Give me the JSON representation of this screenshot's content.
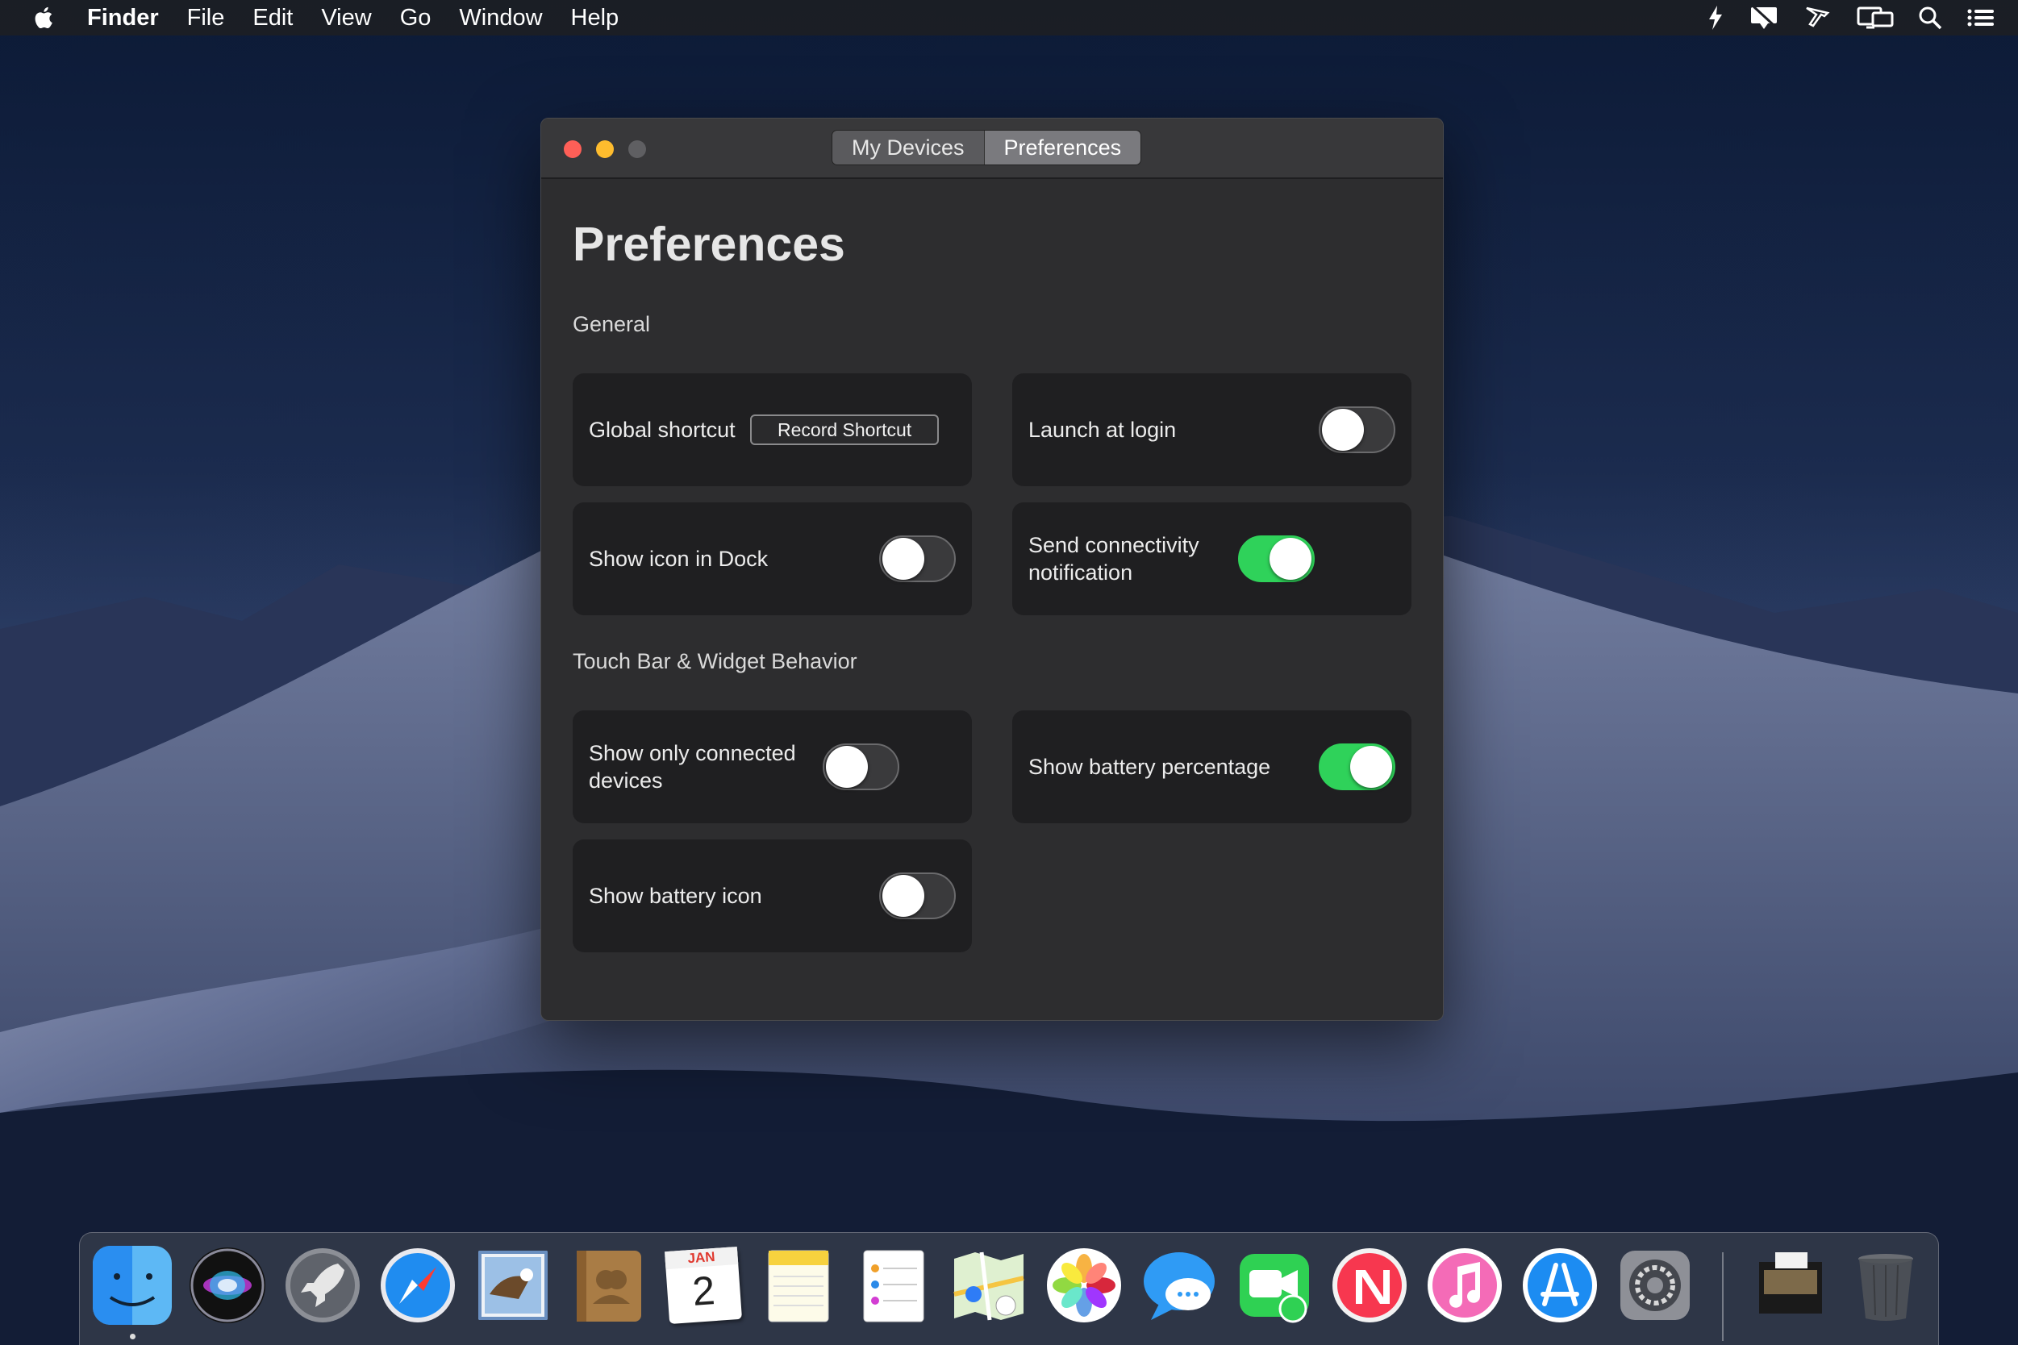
{
  "menubar": {
    "app_name": "Finder",
    "items": [
      "File",
      "Edit",
      "View",
      "Go",
      "Window",
      "Help"
    ],
    "status_icons": [
      "bolt-icon",
      "notification-icon",
      "airplay-icon",
      "displays-icon",
      "search-icon",
      "list-icon"
    ]
  },
  "window": {
    "tabs": [
      {
        "label": "My Devices",
        "selected": false
      },
      {
        "label": "Preferences",
        "selected": true
      }
    ],
    "title": "Preferences",
    "sections": [
      {
        "label": "General",
        "cards": [
          {
            "label": "Global shortcut",
            "control": "button",
            "button_label": "Record Shortcut"
          },
          {
            "label": "Launch at login",
            "control": "toggle",
            "on": false
          },
          {
            "label": "Show icon in Dock",
            "control": "toggle",
            "on": false
          },
          {
            "label": "Send connectivity notification",
            "control": "toggle",
            "on": true
          }
        ]
      },
      {
        "label": "Touch Bar & Widget Behavior",
        "cards": [
          {
            "label": "Show only connected devices",
            "control": "toggle",
            "on": false
          },
          {
            "label": "Show battery percentage",
            "control": "toggle",
            "on": true
          },
          {
            "label": "Show battery icon",
            "control": "toggle",
            "on": false
          }
        ]
      }
    ]
  },
  "dock": {
    "apps": [
      "finder",
      "siri",
      "launchpad",
      "safari",
      "mail",
      "contacts",
      "calendar",
      "notes",
      "reminders",
      "maps",
      "photos",
      "messages",
      "facetime",
      "news",
      "itunes",
      "app-store",
      "system-preferences",
      "downloads",
      "trash"
    ],
    "calendar": {
      "month": "JAN",
      "day": "2"
    }
  },
  "colors": {
    "toggle_on": "#2fd25a",
    "close": "#fe5f57",
    "minimize": "#febc2e"
  }
}
